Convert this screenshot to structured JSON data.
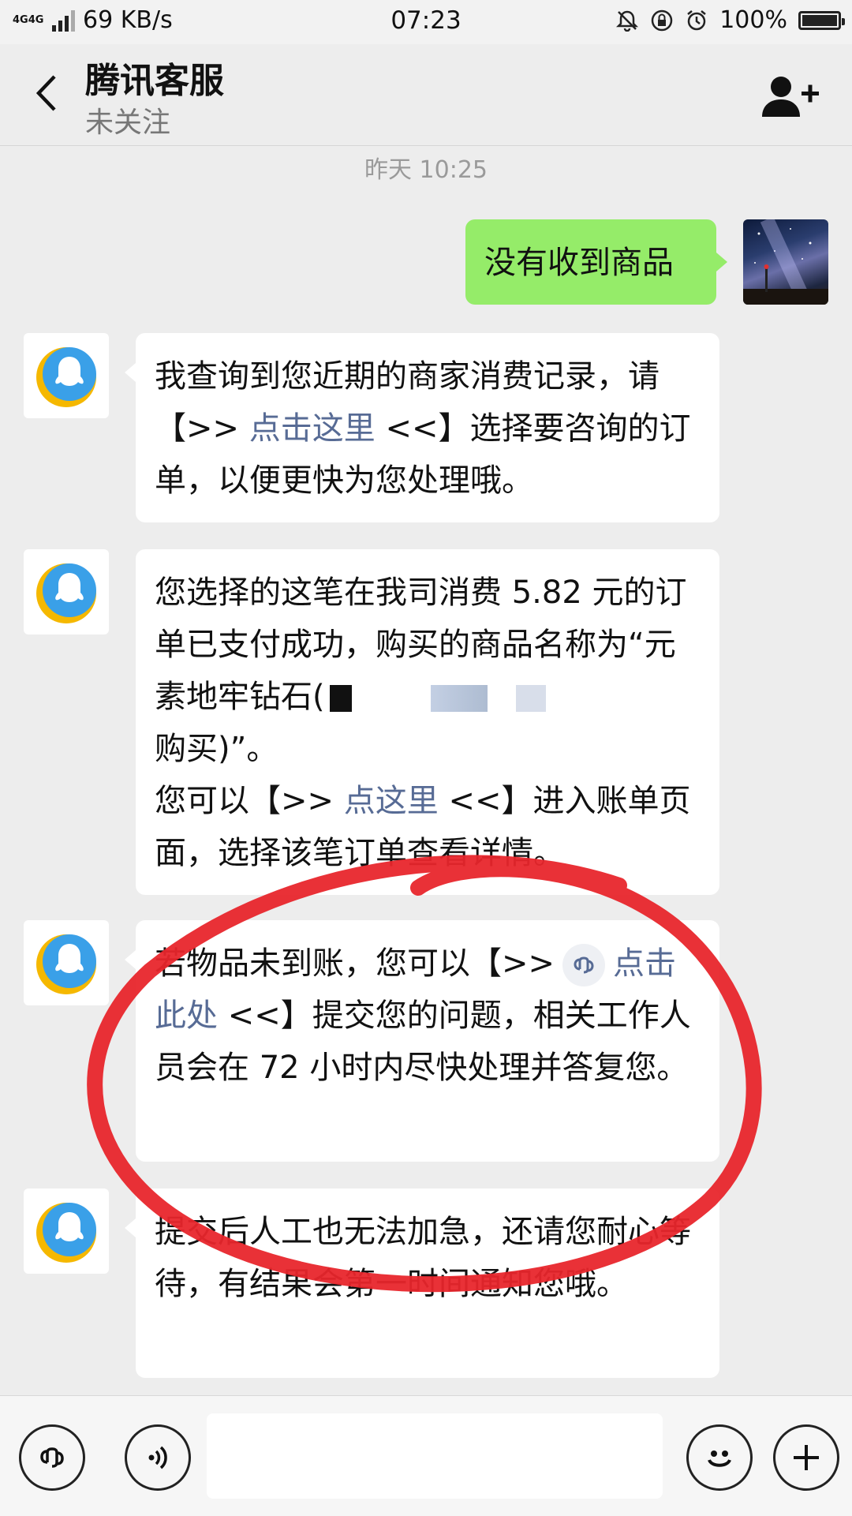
{
  "status_bar": {
    "network": "4G4G",
    "speed": "69 KB/s",
    "time": "07:23",
    "battery": "100%"
  },
  "header": {
    "title": "腾讯客服",
    "subtitle": "未关注"
  },
  "chat": {
    "timestamp": "昨天 10:25",
    "user_message": "没有收到商品",
    "msg1": {
      "part1": "我查询到您近期的商家消费记录，请【>> ",
      "link": "点击这里",
      "part2": " <<】选择要咨询的订单，以便更快为您处理哦。"
    },
    "msg2": {
      "part1": "您选择的这笔在我司消费 5.82 元的订单已支付成功，购买的商品名称为“元素地牢钻石(",
      "part2": "购买)”。",
      "part3": "您可以【>> ",
      "link": "点这里",
      "part4": " <<】进入账单页面，选择该笔订单查看详情。"
    },
    "msg3": {
      "part1": "若物品未到账，您可以【>>",
      "link": "点击此处",
      "part2": " <<】提交您的问题，相关工作人员会在 72 小时内尽快处理并答复您。"
    },
    "msg4": {
      "text": "提交后人工也无法加急，还请您耐心等待，有结果会第一时间通知您哦。"
    }
  },
  "colors": {
    "link": "#576b95",
    "user_bubble": "#95ec69",
    "annotation": "#e8262c"
  }
}
